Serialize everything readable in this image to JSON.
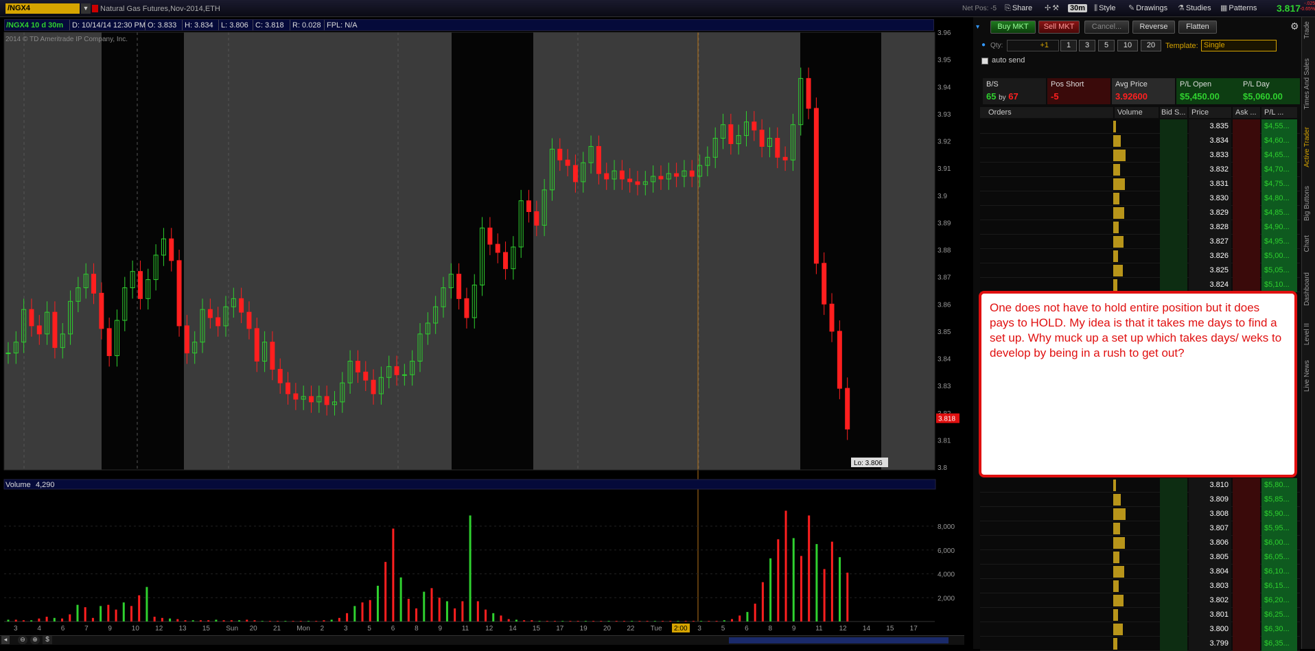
{
  "toolbar": {
    "symbol": "/NGX4",
    "description": "Natural Gas Futures,Nov-2014,ETH",
    "net_pos": "Net Pos: -5",
    "share": "Share",
    "timeframe": "30m",
    "style": "Style",
    "drawings": "Drawings",
    "studies": "Studies",
    "patterns": "Patterns",
    "last_price": "3.817",
    "change_small": "-.025",
    "change_pct": "-0.65%"
  },
  "infobar": {
    "label": "/NGX4 10 d 30m",
    "date": "D: 10/14/14 12:30 PM",
    "open": "O: 3.833",
    "high": "H: 3.834",
    "low": "L: 3.806",
    "close": "C: 3.818",
    "range": "R: 0.028",
    "fpl": "FPL: N/A"
  },
  "copyright": "2014 © TD Ameritrade IP Company, Inc.",
  "price_axis": [
    "3.96",
    "3.95",
    "3.94",
    "3.93",
    "3.92",
    "3.91",
    "3.9",
    "3.89",
    "3.88",
    "3.87",
    "3.86",
    "3.85",
    "3.84",
    "3.83",
    "3.82",
    "3.81",
    "3.8"
  ],
  "price_marker": "3.818",
  "low_marker": "Lo: 3.806",
  "volume_label": "Volume",
  "volume_value": "4,290",
  "volume_axis": [
    "8,000",
    "6,000",
    "4,000",
    "2,000"
  ],
  "time_axis": [
    "3",
    "4",
    "6",
    "7",
    "9",
    "10",
    "12",
    "13",
    "15",
    "Sun",
    "20",
    "21",
    "Mon",
    "2",
    "3",
    "5",
    "6",
    "8",
    "9",
    "11",
    "12",
    "14",
    "15",
    "17",
    "19",
    "20",
    "22",
    "Tue",
    "2:00",
    "3",
    "5",
    "6",
    "8",
    "9",
    "11",
    "12",
    "14",
    "15",
    "17"
  ],
  "order_buttons": {
    "buy": "Buy MKT",
    "sell": "Sell MKT",
    "cancel": "Cancel...",
    "reverse": "Reverse",
    "flatten": "Flatten"
  },
  "qty": {
    "label": "Qty:",
    "value": "+1",
    "presets": [
      "1",
      "3",
      "5",
      "10",
      "20"
    ],
    "template_label": "Template:",
    "template_value": "Single",
    "auto_send": "auto send"
  },
  "position": {
    "bs_label": "B/S",
    "bs_buy": "65",
    "bs_by": "by",
    "bs_sell": "67",
    "pos_label": "Pos Short",
    "pos_value": "-5",
    "avg_label": "Avg Price",
    "avg_value": "3.92600",
    "plopen_label": "P/L Open",
    "plopen_value": "$5,450.00",
    "plday_label": "P/L Day",
    "plday_value": "$5,060.00"
  },
  "ladder_headers": [
    "Orders",
    "Volume",
    "Bid S...",
    "Price",
    "Ask ...",
    "P/L ..."
  ],
  "ladder_top": [
    {
      "price": "3.835",
      "pl": "$4,55..."
    },
    {
      "price": "3.834",
      "pl": "$4,60..."
    },
    {
      "price": "3.833",
      "pl": "$4,65..."
    },
    {
      "price": "3.832",
      "pl": "$4,70..."
    },
    {
      "price": "3.831",
      "pl": "$4,75..."
    },
    {
      "price": "3.830",
      "pl": "$4,80..."
    },
    {
      "price": "3.829",
      "pl": "$4,85..."
    },
    {
      "price": "3.828",
      "pl": "$4,90..."
    },
    {
      "price": "3.827",
      "pl": "$4,95..."
    },
    {
      "price": "3.826",
      "pl": "$5,00..."
    },
    {
      "price": "3.825",
      "pl": "$5,05..."
    },
    {
      "price": "3.824",
      "pl": "$5,10..."
    }
  ],
  "ladder_bottom": [
    {
      "price": "3.810",
      "pl": "$5,80..."
    },
    {
      "price": "3.809",
      "pl": "$5,85..."
    },
    {
      "price": "3.808",
      "pl": "$5,90..."
    },
    {
      "price": "3.807",
      "pl": "$5,95..."
    },
    {
      "price": "3.806",
      "pl": "$6,00..."
    },
    {
      "price": "3.805",
      "pl": "$6,05..."
    },
    {
      "price": "3.804",
      "pl": "$6,10..."
    },
    {
      "price": "3.803",
      "pl": "$6,15..."
    },
    {
      "price": "3.802",
      "pl": "$6,20..."
    },
    {
      "price": "3.801",
      "pl": "$6,25..."
    },
    {
      "price": "3.800",
      "pl": "$6,30..."
    },
    {
      "price": "3.799",
      "pl": "$6,35..."
    }
  ],
  "side_tabs": [
    "Trade",
    "Times And Sales",
    "Active Trader",
    "Big Buttons",
    "Chart",
    "Dashboard",
    "Level II",
    "Live News"
  ],
  "annotation": "One does not have to hold entire position but it does pays to HOLD. My idea is that it takes me days to find a set up. Why muck up a set up which takes days/ weks to develop by being in a rush to get out?",
  "colors": {
    "up": "#2fd12f",
    "down": "#ff1f1f",
    "session_bg": "#3b3b3b",
    "accent": "#d6a400"
  }
}
